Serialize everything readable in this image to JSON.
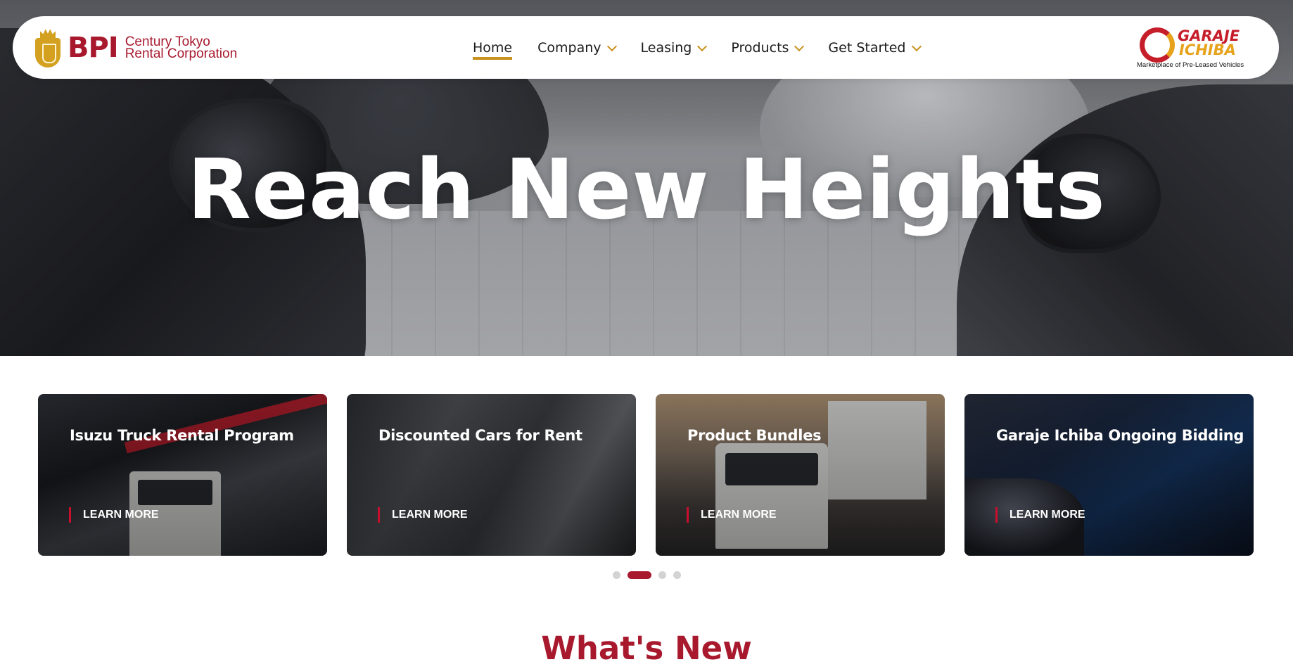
{
  "header": {
    "brand": {
      "main": "BPI",
      "sub_line1": "Century Tokyo",
      "sub_line2": "Rental Corporation"
    },
    "nav": [
      {
        "label": "Home",
        "active": true,
        "dropdown": false
      },
      {
        "label": "Company",
        "active": false,
        "dropdown": true
      },
      {
        "label": "Leasing",
        "active": false,
        "dropdown": true
      },
      {
        "label": "Products",
        "active": false,
        "dropdown": true
      },
      {
        "label": "Get Started",
        "active": false,
        "dropdown": true
      }
    ],
    "partner_logo": {
      "line1": "GARAJE",
      "line2": "ICHIBA",
      "tagline": "Marketplace of  Pre-Leased Vehicles"
    }
  },
  "hero": {
    "title": "Reach New Heights"
  },
  "cards": [
    {
      "title": "Isuzu Truck Rental Program",
      "cta": "LEARN MORE"
    },
    {
      "title": "Discounted Cars for Rent",
      "cta": "LEARN MORE"
    },
    {
      "title": "Product Bundles",
      "cta": "LEARN MORE"
    },
    {
      "title": "Garaje Ichiba Ongoing Bidding",
      "cta": "LEARN MORE"
    }
  ],
  "carousel": {
    "total_pages": 4,
    "active_page": 2
  },
  "sections": {
    "whats_new_heading": "What's New"
  },
  "colors": {
    "brand_red": "#a8192e",
    "accent_gold": "#c8921f",
    "cta_bar_red": "#c8102e"
  }
}
